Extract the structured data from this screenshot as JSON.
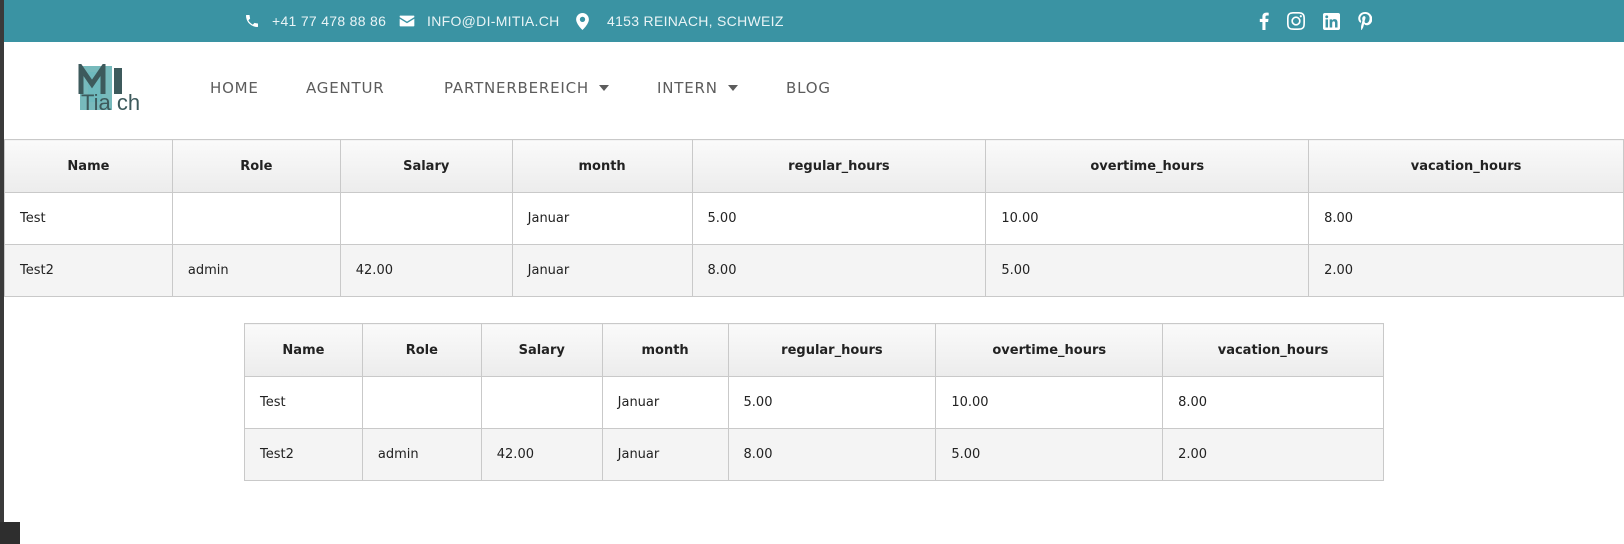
{
  "topbar": {
    "phone": "+41 77 478 88 86",
    "email": "INFO@DI-MITIA.CH",
    "address": "4153 REINACH, SCHWEIZ",
    "social": [
      "facebook-icon",
      "instagram-icon",
      "linkedin-icon",
      "pinterest-icon"
    ]
  },
  "colors": {
    "topbar": "#3a93a3",
    "accent": "#4aa3a6",
    "logo_dark": "#3d5a5c"
  },
  "logo": {
    "text": "Tia ch"
  },
  "nav": {
    "home": "HOME",
    "agentur": "AGENTUR",
    "partnerbereich": "PARTNERBEREICH",
    "intern": "INTERN",
    "blog": "BLOG"
  },
  "tables": [
    {
      "headers": [
        "Name",
        "Role",
        "Salary",
        "month",
        "regular_hours",
        "overtime_hours",
        "vacation_hours"
      ],
      "rows": [
        [
          "Test",
          "",
          "",
          "Januar",
          "5.00",
          "10.00",
          "8.00"
        ],
        [
          "Test2",
          "admin",
          "42.00",
          "Januar",
          "8.00",
          "5.00",
          "2.00"
        ]
      ]
    },
    {
      "headers": [
        "Name",
        "Role",
        "Salary",
        "month",
        "regular_hours",
        "overtime_hours",
        "vacation_hours"
      ],
      "rows": [
        [
          "Test",
          "",
          "",
          "Januar",
          "5.00",
          "10.00",
          "8.00"
        ],
        [
          "Test2",
          "admin",
          "42.00",
          "Januar",
          "8.00",
          "5.00",
          "2.00"
        ]
      ]
    }
  ]
}
